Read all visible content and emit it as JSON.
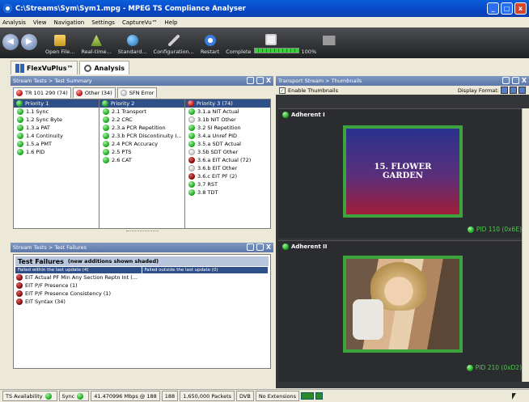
{
  "window": {
    "title": "C:\\Streams\\Sym\\Sym1.mpg - MPEG TS Compliance Analyser"
  },
  "menu": [
    "Analysis",
    "View",
    "Navigation",
    "Settings",
    "CaptureVu™",
    "Help"
  ],
  "toolbar": {
    "open": "Open File...",
    "realtime": "Real-time...",
    "standard": "Standard...",
    "configuration": "Configuration...",
    "restart": "Restart",
    "complete": "Complete",
    "progress_label": "100%",
    "progress_value": 1.0
  },
  "main_tabs": [
    "FlexVuPlus™",
    "Analysis"
  ],
  "test_summary": {
    "header": "Stream Tests > Test Summary",
    "subtabs": [
      "TR 101 290 (74)",
      "Other (34)",
      "SFN Error"
    ],
    "columns": [
      {
        "title": "Priority 1",
        "items": [
          {
            "label": "1.1 Sync",
            "status": "green"
          },
          {
            "label": "1.2 Sync Byte",
            "status": "green"
          },
          {
            "label": "1.3.a PAT",
            "status": "green"
          },
          {
            "label": "1.4 Continuity",
            "status": "green"
          },
          {
            "label": "1.5.a PMT",
            "status": "green"
          },
          {
            "label": "1.6 PID",
            "status": "green"
          }
        ]
      },
      {
        "title": "Priority 2",
        "items": [
          {
            "label": "2.1 Transport",
            "status": "green"
          },
          {
            "label": "2.2 CRC",
            "status": "green"
          },
          {
            "label": "2.3.a PCR Repetition",
            "status": "green"
          },
          {
            "label": "2.3.b PCR Discontinuity I...",
            "status": "green"
          },
          {
            "label": "2.4 PCR Accuracy",
            "status": "green"
          },
          {
            "label": "2.5 PTS",
            "status": "green"
          },
          {
            "label": "2.6 CAT",
            "status": "green"
          }
        ]
      },
      {
        "title": "Priority 3 (74)",
        "items": [
          {
            "label": "3.1.a NIT Actual",
            "status": "green"
          },
          {
            "label": "3.1b NIT Other",
            "status": "white"
          },
          {
            "label": "3.2 SI Repetition",
            "status": "green"
          },
          {
            "label": "3.4.a Unref PID",
            "status": "green"
          },
          {
            "label": "3.5.a SDT Actual",
            "status": "green"
          },
          {
            "label": "3.5b SDT Other",
            "status": "white"
          },
          {
            "label": "3.6.a EIT Actual (72)",
            "status": "darkred"
          },
          {
            "label": "3.6.b EIT Other",
            "status": "white"
          },
          {
            "label": "3.6.c EIT PF (2)",
            "status": "darkred"
          },
          {
            "label": "3.7 RST",
            "status": "green"
          },
          {
            "label": "3.8 TDT",
            "status": "green"
          }
        ]
      }
    ]
  },
  "test_failures": {
    "header": "Stream Tests > Test Failures",
    "title": "Test Failures",
    "subtitle": "(new additions shown shaded)",
    "left_header": "Failed within the last update (4)",
    "right_header": "Failed outside the last update (0)",
    "items": [
      "EIT Actual PF Min Any Section Reptn Int (...",
      "EIT P/F Presence (1)",
      "EIT P/F Presence Consistency (1)",
      "EIT Syntax (34)"
    ]
  },
  "thumbnails": {
    "header": "Transport Stream > Thumbnails",
    "enable_label": "Enable Thumbnails",
    "display_format_label": "Display Format:",
    "services": [
      {
        "name": "Adherent I",
        "pid": "PID 110 (0x6E)",
        "slide_text_1": "15. FLOWER",
        "slide_text_2": "GARDEN"
      },
      {
        "name": "Adherent II",
        "pid": "PID 210 (0xD2)"
      }
    ]
  },
  "statusbar": {
    "ts_availability": "TS Availability",
    "sync": "Sync",
    "bitrate": "41.470996 Mbps @ 188",
    "packet_size": "188",
    "packets": "1,650,000 Packets",
    "dvb": "DVB",
    "extensions": "No Extensions"
  }
}
